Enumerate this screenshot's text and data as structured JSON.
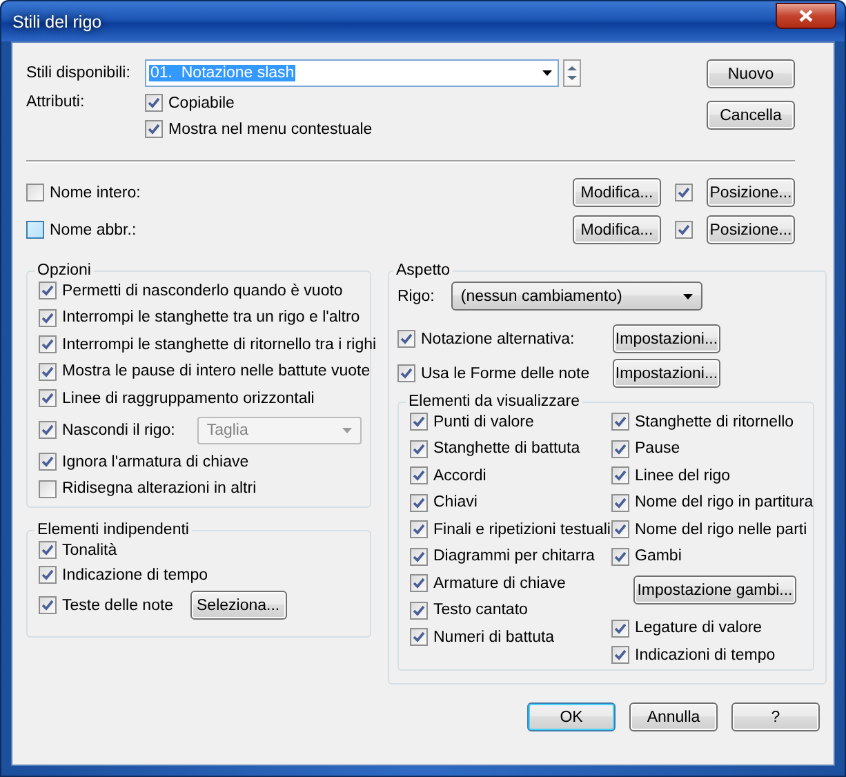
{
  "window": {
    "title": "Stili del rigo"
  },
  "styles_field": {
    "label": "Stili disponibili:",
    "value": "01.  Notazione slash"
  },
  "attributes": {
    "label": "Attributi:",
    "options": [
      {
        "label": "Copiabile",
        "checked": true
      },
      {
        "label": "Mostra nel menu contestuale",
        "checked": true
      }
    ]
  },
  "side_buttons": [
    "Nuovo",
    "Cancella"
  ],
  "names": [
    {
      "label": "Nome intero:",
      "checked": false,
      "hovered": false,
      "edit_button": "Modifica...",
      "show_checked": true,
      "position_button": "Posizione..."
    },
    {
      "label": "Nome abbr.:",
      "checked": false,
      "hovered": true,
      "edit_button": "Modifica...",
      "show_checked": true,
      "position_button": "Posizione..."
    }
  ],
  "options": {
    "title": "Opzioni",
    "items": [
      {
        "kind": "check",
        "label": "Permetti di nasconderlo quando è vuoto",
        "checked": true
      },
      {
        "kind": "check",
        "label": "Interrompi le stanghette tra un rigo e l'altro",
        "checked": true
      },
      {
        "kind": "check",
        "label": "Interrompi le stanghette di ritornello tra i righi",
        "checked": true
      },
      {
        "kind": "check",
        "label": "Mostra le pause di intero nelle battute vuote",
        "checked": true
      },
      {
        "kind": "check",
        "label": "Linee di raggruppamento orizzontali",
        "checked": true
      },
      {
        "kind": "select",
        "label": "Nascondi il rigo:",
        "checked": true,
        "value": "Taglia",
        "disabled": true
      },
      {
        "kind": "check",
        "label": "Ignora l'armatura di chiave",
        "checked": true
      },
      {
        "kind": "check",
        "label": "Ridisegna alterazioni in altri",
        "checked": false
      }
    ]
  },
  "independent": {
    "title": "Elementi indipendenti",
    "items": [
      {
        "label": "Tonalità",
        "checked": true
      },
      {
        "label": "Indicazione di tempo",
        "checked": true
      },
      {
        "label": "Teste delle note",
        "checked": true,
        "button": "Seleziona..."
      }
    ]
  },
  "appearance": {
    "title": "Aspetto",
    "staff": {
      "label": "Rigo:",
      "value": "(nessun cambiamento)"
    },
    "toggles": [
      {
        "label": "Notazione alternativa:",
        "checked": true,
        "button": "Impostazioni..."
      },
      {
        "label": "Usa le Forme delle note",
        "checked": true,
        "button": "Impostazioni..."
      }
    ],
    "elements": {
      "title": "Elementi da visualizzare",
      "left": [
        {
          "kind": "check",
          "label": "Punti di valore",
          "checked": true
        },
        {
          "kind": "check",
          "label": "Stanghette di battuta",
          "checked": true
        },
        {
          "kind": "check",
          "label": "Accordi",
          "checked": true
        },
        {
          "kind": "check",
          "label": "Chiavi",
          "checked": true
        },
        {
          "kind": "check",
          "label": "Finali e ripetizioni testuali",
          "checked": true
        },
        {
          "kind": "check",
          "label": "Diagrammi per chitarra",
          "checked": true
        },
        {
          "kind": "check",
          "label": "Armature di chiave",
          "checked": true
        },
        {
          "kind": "check",
          "label": "Testo cantato",
          "checked": true
        },
        {
          "kind": "check",
          "label": "Numeri di battuta",
          "checked": true
        }
      ],
      "right": [
        {
          "kind": "check",
          "label": "Stanghette di ritornello",
          "checked": true
        },
        {
          "kind": "check",
          "label": "Pause",
          "checked": true
        },
        {
          "kind": "check",
          "label": "Linee del rigo",
          "checked": true
        },
        {
          "kind": "check",
          "label": "Nome del rigo in partitura",
          "checked": true
        },
        {
          "kind": "check",
          "label": "Nome del rigo nelle parti",
          "checked": true
        },
        {
          "kind": "check",
          "label": "Gambi",
          "checked": true
        },
        {
          "kind": "button",
          "label": "Impostazione gambi..."
        },
        {
          "kind": "check",
          "label": "Legature di valore",
          "checked": true
        },
        {
          "kind": "check",
          "label": "Indicazioni di tempo",
          "checked": true
        }
      ]
    }
  },
  "footer_buttons": [
    {
      "label": "OK",
      "default": true
    },
    {
      "label": "Annulla",
      "default": false
    },
    {
      "label": "?",
      "default": false
    }
  ]
}
